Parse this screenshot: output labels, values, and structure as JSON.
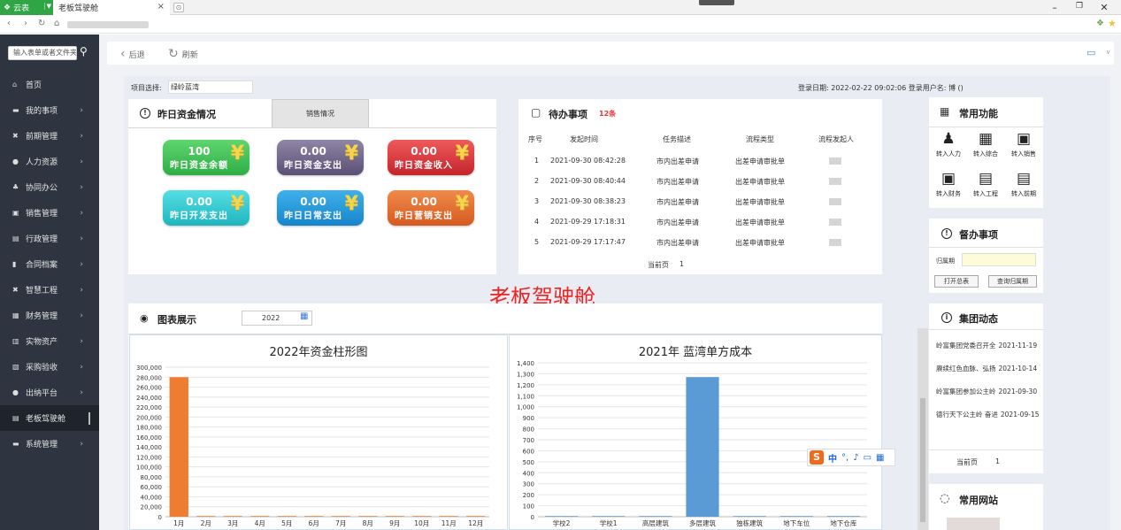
{
  "browser": {
    "app_tab_label": "云表",
    "tab_title": "老板驾驶舱"
  },
  "sidebar": {
    "search_placeholder": "输入表单或者文件夹",
    "items": [
      {
        "icon": "home-icon",
        "glyph": "⌂",
        "label": "首页",
        "chevron": false
      },
      {
        "icon": "folder-icon",
        "glyph": "▬",
        "label": "我的事项",
        "chevron": true
      },
      {
        "icon": "tools-icon",
        "glyph": "✖",
        "label": "前期管理",
        "chevron": true
      },
      {
        "icon": "user-icon",
        "glyph": "●",
        "label": "人力资源",
        "chevron": true
      },
      {
        "icon": "org-icon",
        "glyph": "♣",
        "label": "协同办公",
        "chevron": true
      },
      {
        "icon": "sales-icon",
        "glyph": "▣",
        "label": "销售管理",
        "chevron": true
      },
      {
        "icon": "printer-icon",
        "glyph": "▤",
        "label": "行政管理",
        "chevron": true
      },
      {
        "icon": "contract-icon",
        "glyph": "▮",
        "label": "合同档案",
        "chevron": true
      },
      {
        "icon": "wrench-icon",
        "glyph": "✖",
        "label": "智慧工程",
        "chevron": true
      },
      {
        "icon": "finance-icon",
        "glyph": "▦",
        "label": "财务管理",
        "chevron": true
      },
      {
        "icon": "asset-icon",
        "glyph": "▥",
        "label": "实物资产",
        "chevron": true
      },
      {
        "icon": "purchase-icon",
        "glyph": "▧",
        "label": "采购验收",
        "chevron": true
      },
      {
        "icon": "cashier-icon",
        "glyph": "●",
        "label": "出纳平台",
        "chevron": true
      },
      {
        "icon": "dashboard-icon",
        "glyph": "▤",
        "label": "老板驾驶舱",
        "chevron": false,
        "active": true
      },
      {
        "icon": "folder-icon",
        "glyph": "▬",
        "label": "系统管理",
        "chevron": true
      }
    ]
  },
  "toolbar": {
    "back_label": "后退",
    "refresh_label": "刷新"
  },
  "header": {
    "project_label": "项目选择:",
    "project_value": "绿岭蓝湾",
    "login_info": "登录日期:  2022-02-22 09:02:06   登录用户名: 博 ()"
  },
  "funds": {
    "title": "昨日资金情况",
    "tab_sales": "销售情况",
    "cards": [
      {
        "value": "100",
        "label": "昨日资金余额",
        "color": "green"
      },
      {
        "value": "0.00",
        "label": "昨日资金支出",
        "color": "purple"
      },
      {
        "value": "0.00",
        "label": "昨日资金收入",
        "color": "red"
      },
      {
        "value": "0.00",
        "label": "昨日开发支出",
        "color": "cyan"
      },
      {
        "value": "0.00",
        "label": "昨日日常支出",
        "color": "blue"
      },
      {
        "value": "0.00",
        "label": "昨日营销支出",
        "color": "orange"
      }
    ]
  },
  "todo": {
    "title": "待办事项",
    "count": "12条",
    "headers": [
      "序号",
      "发起时间",
      "任务描述",
      "流程类型",
      "流程发起人"
    ],
    "rows": [
      {
        "no": "1",
        "time": "2021-09-30 08:42:28",
        "desc": "市内出差申请",
        "type": "出差申请审批单"
      },
      {
        "no": "2",
        "time": "2021-09-30 08:40:44",
        "desc": "市内出差申请",
        "type": "出差申请审批单"
      },
      {
        "no": "3",
        "time": "2021-09-30 08:38:23",
        "desc": "市内出差申请",
        "type": "出差申请审批单"
      },
      {
        "no": "4",
        "time": "2021-09-29 17:18:31",
        "desc": "市内出差申请",
        "type": "出差申请审批单"
      },
      {
        "no": "5",
        "time": "2021-09-29 17:17:47",
        "desc": "市内出差申请",
        "type": "出差申请审批单"
      }
    ],
    "pager_label": "当前页",
    "pager_value": "1"
  },
  "common_functions": {
    "title": "常用功能",
    "items": [
      {
        "icon": "transfer-hr-icon",
        "glyph": "♟",
        "label": "转入人力"
      },
      {
        "icon": "transfer-general-icon",
        "glyph": "▦",
        "label": "转入综合"
      },
      {
        "icon": "transfer-sales-icon",
        "glyph": "▣",
        "label": "转入销售"
      },
      {
        "icon": "transfer-finance-icon",
        "glyph": "▣",
        "label": "转入财务"
      },
      {
        "icon": "transfer-engineering-icon",
        "glyph": "▤",
        "label": "转入工程"
      },
      {
        "icon": "transfer-early-icon",
        "glyph": "▤",
        "label": "转入前期"
      }
    ]
  },
  "supervise": {
    "title": "督办事项",
    "field_label": "归属期",
    "btn_open": "打开总表",
    "btn_query": "查询归属期"
  },
  "cockpit_title": "老板驾驶舱",
  "charts": {
    "title": "图表展示",
    "year": "2022"
  },
  "chart_data": [
    {
      "type": "bar",
      "title": "2022年资金柱形图",
      "categories": [
        "1月",
        "2月",
        "3月",
        "4月",
        "5月",
        "6月",
        "7月",
        "8月",
        "9月",
        "10月",
        "11月",
        "12月"
      ],
      "values": [
        280000,
        0,
        0,
        0,
        0,
        0,
        0,
        0,
        0,
        0,
        0,
        0
      ],
      "ylim": [
        0,
        300000
      ],
      "yticks": [
        0,
        20000,
        40000,
        60000,
        80000,
        100000,
        120000,
        140000,
        160000,
        180000,
        200000,
        220000,
        240000,
        260000,
        280000,
        300000
      ],
      "color": "#ef7d31",
      "grid": true
    },
    {
      "type": "bar",
      "title": "2021年     蓝湾单方成本",
      "categories": [
        "学校2",
        "学校1",
        "高层建筑",
        "多层建筑",
        "独栋建筑",
        "地下车位",
        "地下仓库"
      ],
      "values": [
        0,
        0,
        0,
        1270,
        0,
        0,
        0
      ],
      "ylim": [
        0,
        1400
      ],
      "yticks": [
        0,
        100,
        200,
        300,
        400,
        500,
        600,
        700,
        800,
        900,
        1000,
        1100,
        1200,
        1300,
        1400
      ],
      "color": "#5b9bd5",
      "grid": true
    }
  ],
  "group_news": {
    "title": "集团动态",
    "items": [
      {
        "text": "岭富集团党委召开全",
        "date": "2021-11-19"
      },
      {
        "text": "赓续红色血脉、弘扬",
        "date": "2021-10-14"
      },
      {
        "text": "岭富集团参加公主岭",
        "date": "2021-09-30"
      },
      {
        "text": "德行天下公主岭 奋进",
        "date": "2021-09-15"
      }
    ],
    "pager_label": "当前页",
    "pager_value": "1"
  },
  "sites": {
    "title": "常用网站"
  },
  "ime": {
    "logo": "S",
    "lang": "中"
  }
}
